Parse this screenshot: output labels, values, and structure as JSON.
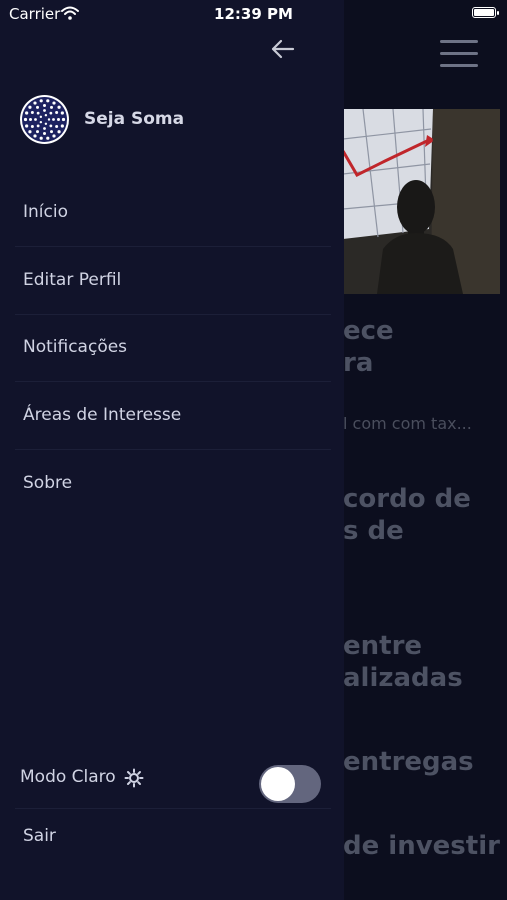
{
  "status_bar": {
    "carrier": "Carrier",
    "time": "12:39 PM"
  },
  "drawer": {
    "profile_name": "Seja Soma",
    "menu": [
      {
        "label": "Início"
      },
      {
        "label": "Editar Perfil"
      },
      {
        "label": "Notificações"
      },
      {
        "label": "Áreas de Interesse"
      },
      {
        "label": "Sobre"
      }
    ],
    "theme_toggle": {
      "label": "Modo Claro",
      "on": false
    },
    "logout_label": "Sair"
  },
  "background": {
    "texts": [
      "ece",
      "ra",
      "cordo de",
      "s de",
      "entre",
      "alizadas",
      "entregas",
      "de investir"
    ],
    "subtitle": "l com com tax..."
  },
  "colors": {
    "drawer_bg": "#11132a",
    "page_bg": "#0c0e1e",
    "text": "#d0d3e3"
  }
}
